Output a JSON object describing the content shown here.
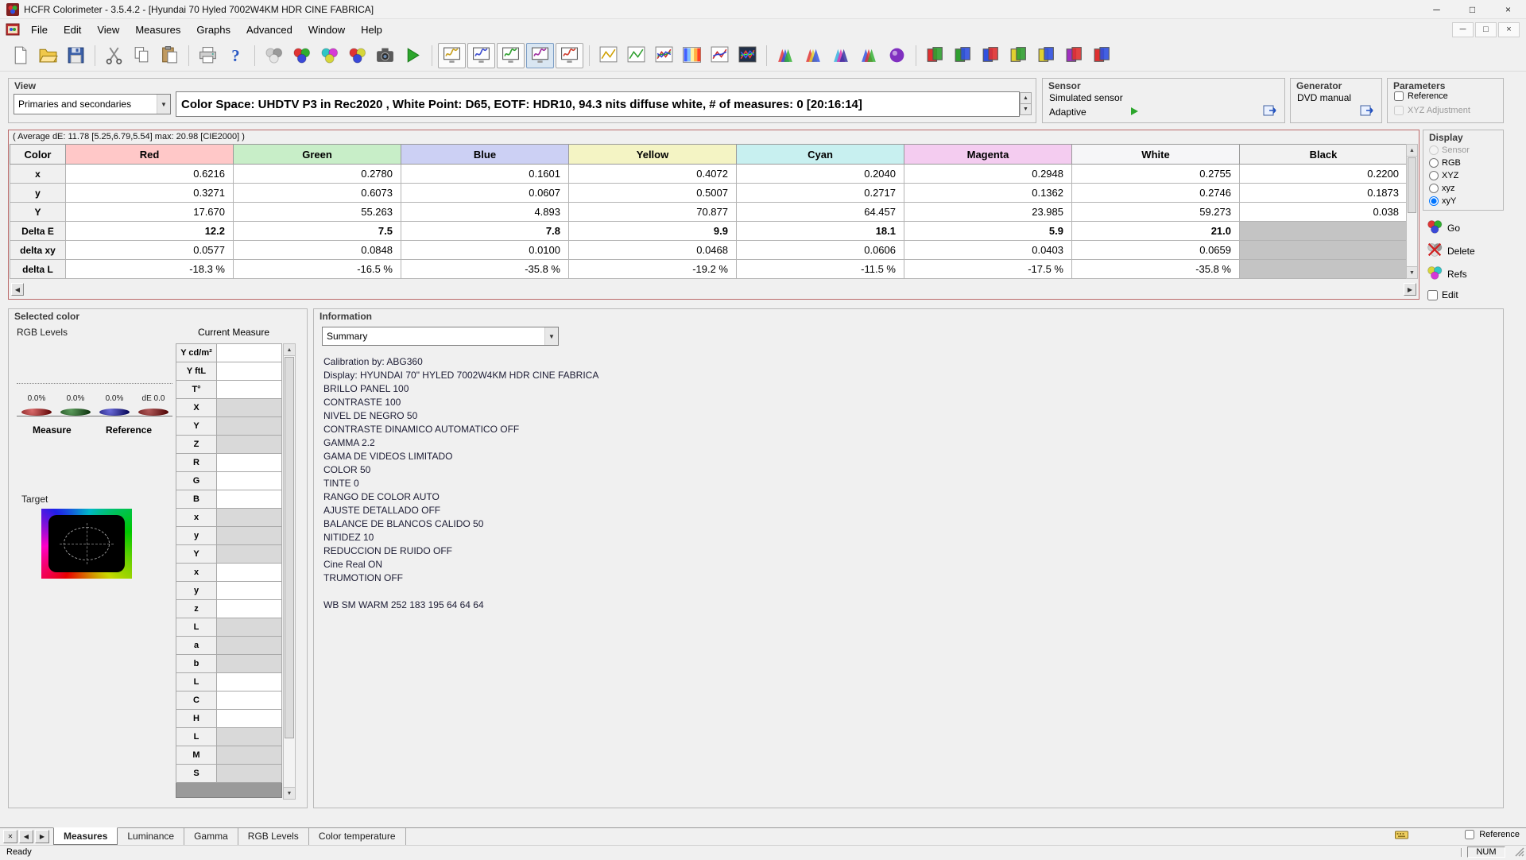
{
  "window": {
    "title": "HCFR Colorimeter - 3.5.4.2 - [Hyundai 70 Hyled 7002W4KM HDR CINE FABRICA]"
  },
  "menu": {
    "items": [
      "File",
      "Edit",
      "View",
      "Measures",
      "Graphs",
      "Advanced",
      "Window",
      "Help"
    ]
  },
  "toolbar": {
    "buttons": [
      {
        "name": "new-file-button",
        "kind": "page"
      },
      {
        "name": "open-file-button",
        "kind": "folder"
      },
      {
        "name": "save-file-button",
        "kind": "floppy"
      },
      {
        "name": "separator",
        "kind": "sep"
      },
      {
        "name": "cut-button",
        "kind": "scissors"
      },
      {
        "name": "copy-button",
        "kind": "copy"
      },
      {
        "name": "paste-button",
        "kind": "paste"
      },
      {
        "name": "separator",
        "kind": "sep"
      },
      {
        "name": "print-button",
        "kind": "printer"
      },
      {
        "name": "help-button",
        "kind": "help"
      },
      {
        "name": "separator",
        "kind": "sep"
      },
      {
        "name": "measure-grayscale-button",
        "kind": "spheres",
        "colors": [
          "#cfcfcf",
          "#9a9a9a",
          "#e6e6e6"
        ]
      },
      {
        "name": "measure-primaries-button",
        "kind": "spheres",
        "colors": [
          "#e03434",
          "#2fae2f",
          "#3a49d8"
        ]
      },
      {
        "name": "measure-secondaries-button",
        "kind": "spheres",
        "colors": [
          "#2fc6c6",
          "#d63ad6",
          "#d6d63a"
        ]
      },
      {
        "name": "measure-all-colors-button",
        "kind": "spheres",
        "colors": [
          "#e03434",
          "#d6d63a",
          "#3a49d8"
        ]
      },
      {
        "name": "capture-button",
        "kind": "camera"
      },
      {
        "name": "start-measures-button",
        "kind": "play"
      },
      {
        "name": "separator",
        "kind": "sep"
      },
      {
        "name": "view-free-measures-button",
        "kind": "monitor",
        "color": "#c8a020",
        "framed": true
      },
      {
        "name": "view-grayscale-button",
        "kind": "monitor",
        "color": "#4050d0",
        "framed": true
      },
      {
        "name": "view-primaries-button",
        "kind": "monitor",
        "color": "#30a030",
        "framed": true
      },
      {
        "name": "view-secondaries-button",
        "kind": "monitor",
        "color": "#a030a0",
        "framed": true,
        "pressed": true
      },
      {
        "name": "view-contrast-button",
        "kind": "monitor",
        "color": "#d04030",
        "framed": true
      },
      {
        "name": "separator",
        "kind": "sep"
      },
      {
        "name": "luminance-graph-button",
        "kind": "chart",
        "colors": [
          "#d0a000"
        ]
      },
      {
        "name": "gamma-graph-button",
        "kind": "chart",
        "colors": [
          "#30a030"
        ]
      },
      {
        "name": "rgb-levels-graph-button",
        "kind": "chart",
        "colors": [
          "#d03030",
          "#30a030",
          "#3040d0"
        ]
      },
      {
        "name": "color-temperature-graph-button",
        "kind": "stripes",
        "colors": [
          "#4060ff",
          "#80c0ff",
          "#fff0a0",
          "#ffb040",
          "#ff4020"
        ]
      },
      {
        "name": "cie-chart-button",
        "kind": "chart",
        "colors": [
          "#d03030",
          "#3040d0"
        ]
      },
      {
        "name": "measures-histogram-button",
        "kind": "darkchart",
        "colors": [
          "#ff4040",
          "#40ff40",
          "#4060ff"
        ]
      },
      {
        "name": "separator",
        "kind": "sep"
      },
      {
        "name": "gamut-3d-button-1",
        "kind": "tri",
        "colors": [
          "#e03030",
          "#3050e0",
          "#30b030"
        ]
      },
      {
        "name": "gamut-3d-button-2",
        "kind": "tri",
        "colors": [
          "#e03030",
          "#e0d030",
          "#3050e0"
        ]
      },
      {
        "name": "gamut-3d-button-3",
        "kind": "tri",
        "colors": [
          "#30b0e0",
          "#e030b0",
          "#3030a0"
        ]
      },
      {
        "name": "gamut-3d-button-4",
        "kind": "tri",
        "colors": [
          "#3050e0",
          "#e03030",
          "#30b030"
        ]
      },
      {
        "name": "gamut-3d-button-5",
        "kind": "orb",
        "colors": [
          "#8030c0"
        ]
      },
      {
        "name": "separator",
        "kind": "sep"
      },
      {
        "name": "color-tool-button-1",
        "kind": "pages",
        "colors": [
          "#e03030",
          "#30a030"
        ]
      },
      {
        "name": "color-tool-button-2",
        "kind": "pages",
        "colors": [
          "#30a030",
          "#3050e0"
        ]
      },
      {
        "name": "color-tool-button-3",
        "kind": "pages",
        "colors": [
          "#3050e0",
          "#e03030"
        ]
      },
      {
        "name": "color-tool-button-4",
        "kind": "pages",
        "colors": [
          "#e0d030",
          "#30a030"
        ]
      },
      {
        "name": "color-tool-button-5",
        "kind": "pages",
        "colors": [
          "#e0d030",
          "#3050e0"
        ]
      },
      {
        "name": "color-tool-button-6",
        "kind": "pages",
        "colors": [
          "#a030c0",
          "#e03030"
        ]
      },
      {
        "name": "color-tool-button-7",
        "kind": "pages",
        "colors": [
          "#e03030",
          "#3050e0"
        ]
      }
    ]
  },
  "view_panel": {
    "label": "View",
    "mode": "Primaries and secondaries",
    "status": "Color Space: UHDTV P3 in Rec2020 , White Point: D65, EOTF:  HDR10, 94.3 nits diffuse white, # of measures: 0 [20:16:14]"
  },
  "sensor_panel": {
    "label": "Sensor",
    "name": "Simulated sensor",
    "mode": "Adaptive"
  },
  "generator_panel": {
    "label": "Generator",
    "name": "DVD manual"
  },
  "parameters_panel": {
    "label": "Parameters",
    "reference": "Reference",
    "xyz_adjustment": "XYZ Adjustment"
  },
  "measures": {
    "average": "( Average dE: 11.78 [5.25,6.79,5.54] max: 20.98 [CIE2000] )",
    "columns": [
      {
        "label": "Color",
        "bg": "#f0f0f0"
      },
      {
        "label": "Red",
        "bg": "#ffc8c8"
      },
      {
        "label": "Green",
        "bg": "#c8eec8"
      },
      {
        "label": "Blue",
        "bg": "#ccd0f4"
      },
      {
        "label": "Yellow",
        "bg": "#f4f4c4"
      },
      {
        "label": "Cyan",
        "bg": "#c8f0f0"
      },
      {
        "label": "Magenta",
        "bg": "#f4ccf0"
      },
      {
        "label": "White",
        "bg": "#f6f6f8"
      },
      {
        "label": "Black",
        "bg": "#f2f2f2"
      }
    ],
    "rows": [
      {
        "label": "x",
        "variant": "normal",
        "cells": [
          "0.6216",
          "0.2780",
          "0.1601",
          "0.4072",
          "0.2040",
          "0.2948",
          "0.2755",
          "0.2200"
        ]
      },
      {
        "label": "y",
        "variant": "normal",
        "cells": [
          "0.3271",
          "0.6073",
          "0.0607",
          "0.5007",
          "0.2717",
          "0.1362",
          "0.2746",
          "0.1873"
        ]
      },
      {
        "label": "Y",
        "variant": "normal",
        "cells": [
          "17.670",
          "55.263",
          "4.893",
          "70.877",
          "64.457",
          "23.985",
          "59.273",
          "0.038"
        ]
      },
      {
        "label": "Delta E",
        "variant": "deltaE",
        "cells": [
          "12.2",
          "7.5",
          "7.8",
          "9.9",
          "18.1",
          "5.9",
          "21.0",
          ""
        ]
      },
      {
        "label": "delta xy",
        "variant": "deltaGray",
        "cells": [
          "0.0577",
          "0.0848",
          "0.0100",
          "0.0468",
          "0.0606",
          "0.0403",
          "0.0659",
          ""
        ]
      },
      {
        "label": "delta L",
        "variant": "deltaGrayShade",
        "cells": [
          "-18.3 %",
          "-16.5 %",
          "-35.8 %",
          "-19.2 %",
          "-11.5 %",
          "-17.5 %",
          "-35.8 %",
          ""
        ]
      }
    ]
  },
  "display_panel": {
    "label": "Display",
    "options": [
      {
        "label": "Sensor",
        "disabled": true,
        "selected": false
      },
      {
        "label": "RGB",
        "disabled": false,
        "selected": false
      },
      {
        "label": "XYZ",
        "disabled": false,
        "selected": false
      },
      {
        "label": "xyz",
        "disabled": false,
        "selected": false
      },
      {
        "label": "xyY",
        "disabled": false,
        "selected": true
      }
    ],
    "buttons": [
      {
        "label": "Go",
        "icon": "go"
      },
      {
        "label": "Delete",
        "icon": "del"
      },
      {
        "label": "Refs",
        "icon": "refs"
      }
    ],
    "edit_label": "Edit"
  },
  "selected_color": {
    "label": "Selected color",
    "rgb_levels_label": "RGB Levels",
    "bars": [
      {
        "value": "0.0%",
        "light": "#d96a6a",
        "dark": "#5a0000"
      },
      {
        "value": "0.0%",
        "light": "#5a9a5a",
        "dark": "#0a2e0a"
      },
      {
        "value": "0.0%",
        "light": "#6a6ad9",
        "dark": "#00004f"
      },
      {
        "value": "dE 0.0",
        "light": "#b05858",
        "dark": "#4a0000"
      }
    ],
    "measure_label": "Measure",
    "reference_label": "Reference",
    "target_label": "Target"
  },
  "current_measure": {
    "label": "Current Measure",
    "rows": [
      {
        "label": "Y cd/m²",
        "shaded": false
      },
      {
        "label": "Y ftL",
        "shaded": false
      },
      {
        "label": "T°",
        "shaded": false
      },
      {
        "label": "X",
        "shaded": true
      },
      {
        "label": "Y",
        "shaded": true
      },
      {
        "label": "Z",
        "shaded": true
      },
      {
        "label": "R",
        "shaded": false
      },
      {
        "label": "G",
        "shaded": false
      },
      {
        "label": "B",
        "shaded": false
      },
      {
        "label": "x",
        "shaded": true
      },
      {
        "label": "y",
        "shaded": true
      },
      {
        "label": "Y",
        "shaded": true
      },
      {
        "label": "x",
        "shaded": false
      },
      {
        "label": "y",
        "shaded": false
      },
      {
        "label": "z",
        "shaded": false
      },
      {
        "label": "L",
        "shaded": true
      },
      {
        "label": "a",
        "shaded": true
      },
      {
        "label": "b",
        "shaded": true
      },
      {
        "label": "L",
        "shaded": false
      },
      {
        "label": "C",
        "shaded": false
      },
      {
        "label": "H",
        "shaded": false
      },
      {
        "label": "L",
        "shaded": true
      },
      {
        "label": "M",
        "shaded": true
      },
      {
        "label": "S",
        "shaded": true
      }
    ]
  },
  "information_panel": {
    "label": "Information",
    "view": "Summary",
    "lines": [
      "Calibration by: ABG360",
      "Display: HYUNDAI 70\" HYLED 7002W4KM HDR CINE FABRICA",
      "BRILLO PANEL 100",
      "CONTRASTE 100",
      "NIVEL DE NEGRO 50",
      "CONTRASTE DINAMICO AUTOMATICO OFF",
      "GAMMA 2.2",
      "GAMA DE VIDEOS LIMITADO",
      "COLOR 50",
      "TINTE 0",
      "RANGO DE COLOR AUTO",
      "AJUSTE DETALLADO OFF",
      "BALANCE DE BLANCOS CALIDO 50",
      "NITIDEZ 10",
      "REDUCCION DE RUIDO OFF",
      "Cine Real ON",
      "TRUMOTION OFF",
      "",
      "WB SM WARM 252 183 195 64 64 64"
    ]
  },
  "tabs": {
    "items": [
      {
        "label": "Measures",
        "active": true
      },
      {
        "label": "Luminance",
        "active": false
      },
      {
        "label": "Gamma",
        "active": false
      },
      {
        "label": "RGB Levels",
        "active": false
      },
      {
        "label": "Color temperature",
        "active": false
      }
    ],
    "reference_label": "Reference"
  },
  "status_bar": {
    "ready": "Ready",
    "num": "NUM"
  }
}
